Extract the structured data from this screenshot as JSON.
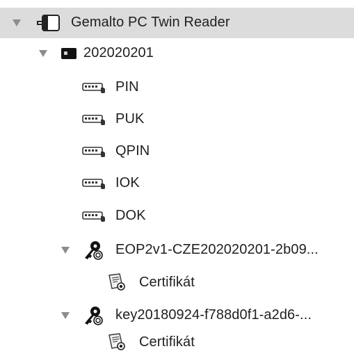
{
  "tree": {
    "reader": {
      "label": "Gemalto PC Twin Reader",
      "icon": "card-reader-icon",
      "expanded": true,
      "selected": true
    },
    "card": {
      "label": "202020201",
      "icon": "smart-card-icon",
      "expanded": true
    },
    "pins": [
      {
        "label": "PIN",
        "icon": "pin-key-icon"
      },
      {
        "label": "PUK",
        "icon": "pin-key-icon"
      },
      {
        "label": "QPIN",
        "icon": "pin-key-icon"
      },
      {
        "label": "IOK",
        "icon": "pin-key-icon"
      },
      {
        "label": "DOK",
        "icon": "pin-key-icon"
      }
    ],
    "keys": [
      {
        "label": "EOP2v1-CZE202020201-2b09...",
        "icon": "key-pair-icon",
        "expanded": true,
        "child": {
          "label": "Certifikát",
          "icon": "certificate-icon"
        }
      },
      {
        "label": "key20180924-f788d0f1-a2d6-...",
        "icon": "key-pair-icon",
        "expanded": true,
        "child": {
          "label": "Certifikát",
          "icon": "certificate-icon"
        }
      }
    ]
  },
  "colors": {
    "selection": "#dcdcdc",
    "disclosure": "#8c8c8c",
    "text": "#1f1f1f"
  }
}
